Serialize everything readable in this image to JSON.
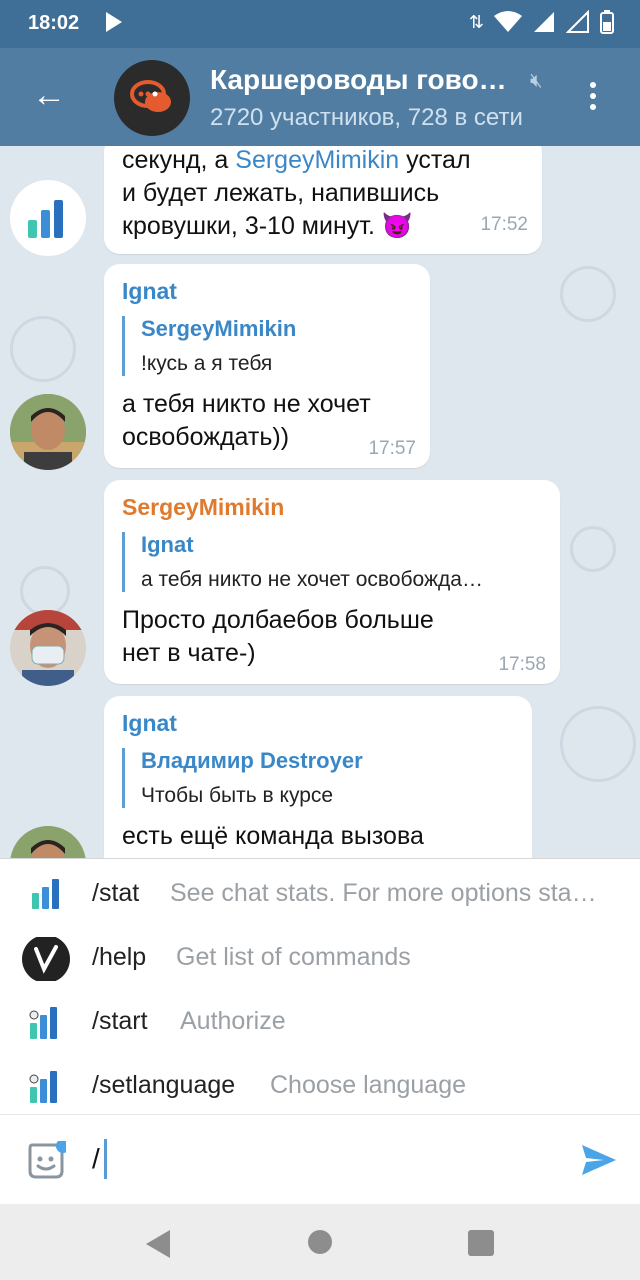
{
  "status_bar": {
    "time": "18:02"
  },
  "header": {
    "title": "Каршероводы гово…",
    "subtitle": "2720 участников, 728 в сети"
  },
  "messages": [
    {
      "text_parts": [
        "секунд, а ",
        "SergeyMimikin",
        " устал"
      ],
      "text_lines": [
        "и будет лежать, напившись",
        "кровушки, 3-10 минут. 😈"
      ],
      "time": "17:52"
    },
    {
      "sender": "Ignat",
      "reply_name": "SergeyMimikin",
      "reply_text": "!кусь а я тебя",
      "text_lines": [
        "а тебя никто не хочет",
        "освобождать))"
      ],
      "time": "17:57"
    },
    {
      "sender": "SergeyMimikin",
      "reply_name": "Ignat",
      "reply_text": "а тебя никто не хочет освобожда…",
      "text_lines": [
        "Просто долбаебов больше",
        "нет в чате-)"
      ],
      "time": "17:58"
    },
    {
      "sender": "Ignat",
      "reply_name": "Владимир Destroyer",
      "reply_text": "Чтобы быть в курсе",
      "text_lines": [
        "есть ещё команда вызова"
      ]
    }
  ],
  "commands": [
    {
      "name": "/stat",
      "desc": "See chat stats. For more options sta…",
      "icon": "stats-bot-icon"
    },
    {
      "name": "/help",
      "desc": "Get list of commands",
      "icon": "v-bot-icon"
    },
    {
      "name": "/start",
      "desc": "Authorize",
      "icon": "stats-bot-icon"
    },
    {
      "name": "/setlanguage",
      "desc": "Choose language",
      "icon": "stats-bot-icon"
    }
  ],
  "input": {
    "value": "/"
  },
  "colors": {
    "header": "#517da2",
    "status_bar": "#3f6f97",
    "link": "#3a87c8",
    "sender_ignat": "#3a87c8",
    "sender_sergey": "#e07a2e",
    "time": "#9aa7b3"
  }
}
